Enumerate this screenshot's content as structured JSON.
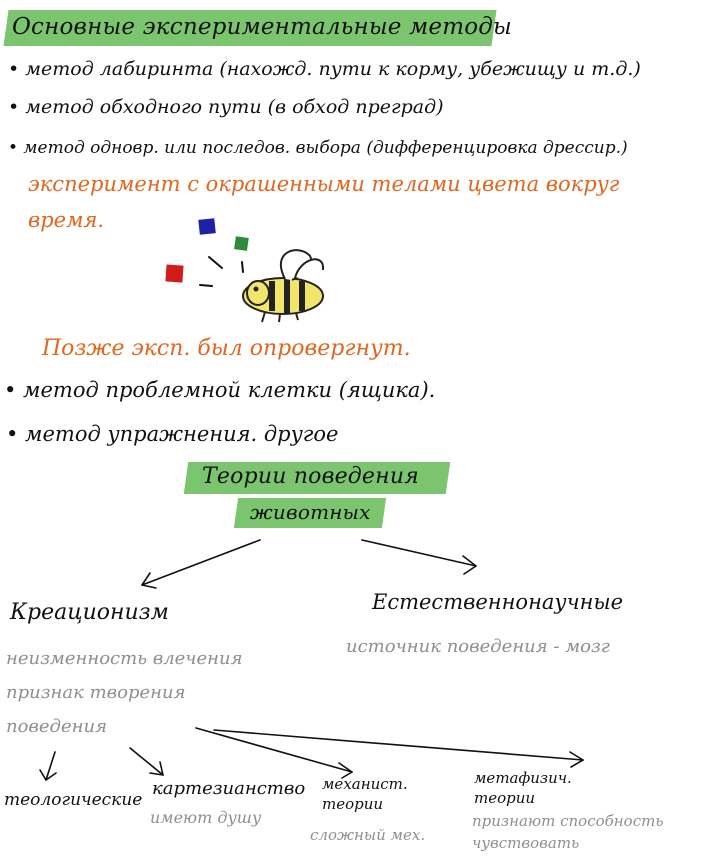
{
  "colors": {
    "highlight": "#7cc56f",
    "orange": "#e2661e",
    "gray": "#8f8f8f",
    "red": "#d21b1b",
    "blue": "#1c22a7",
    "green": "#2e8b3a"
  },
  "header": {
    "title": "Основные экспериментальные методы"
  },
  "methods": [
    "• метод лабиринта (нахожд. пути к корму, убежищу и т.д.)",
    "• метод обходного пути (в обход преград)",
    "• метод одновр. или последов. выбора (дифференцировка дрессир.)"
  ],
  "experiment": {
    "line1": "эксперимент с окрашенными телами цвета вокруг",
    "line2": "время."
  },
  "refuted": "Позже эксп. был опровергнут.",
  "methods2": [
    "• метод проблемной клетки (ящика).",
    "• метод упражнения. другое"
  ],
  "theories": {
    "line1": "Теории поведения",
    "line2": "животных"
  },
  "branches": {
    "left": {
      "title": "Креационизм",
      "desc": [
        "неизменность влечения",
        "признак творения",
        "поведения"
      ]
    },
    "right": {
      "title": "Естественнонаучные",
      "desc": "источник поведения - мозг"
    }
  },
  "subtheories": [
    {
      "title": "теологические",
      "desc": ""
    },
    {
      "title": "картезианство",
      "desc": "имеют душу"
    },
    {
      "title": "механист. теории",
      "desc": "сложный мех."
    },
    {
      "title": "метафизич. теории",
      "desc": "признают способность чувствовать"
    }
  ]
}
